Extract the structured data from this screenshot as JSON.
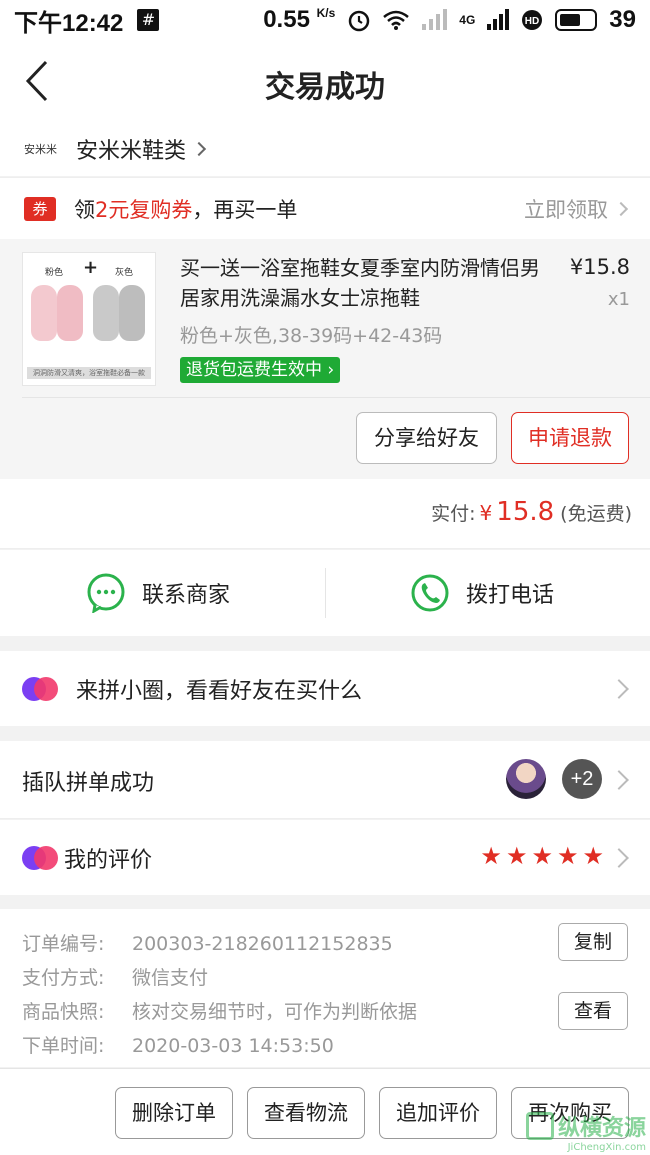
{
  "status_bar": {
    "time": "下午12:42",
    "hash_icon": "#",
    "speed": "0.55",
    "speed_unit": "K/s",
    "network": "4G",
    "battery": "39"
  },
  "header": {
    "title": "交易成功"
  },
  "shop": {
    "logo_text": "安米米",
    "name": "安米米鞋类"
  },
  "coupon": {
    "badge": "券",
    "prefix": "领",
    "highlight": "2元复购券",
    "suffix": "，再买一单",
    "claim": "立即领取"
  },
  "product": {
    "thumb_left_label": "粉色",
    "thumb_right_label": "灰色",
    "thumb_caption": "洞洞防滑又清爽，浴室拖鞋必备一款",
    "title": "买一送一浴室拖鞋女夏季室内防滑情侣男居家用洗澡漏水女士凉拖鞋",
    "price": "¥15.8",
    "qty": "x1",
    "spec": "粉色+灰色,38-39码+42-43码",
    "tag": "退货包运费生效中",
    "share_label": "分享给好友",
    "refund_label": "申请退款"
  },
  "payment": {
    "label": "实付:",
    "currency": "¥",
    "amount": "15.8",
    "shipping": "(免运费)"
  },
  "contact": {
    "merchant_label": "联系商家",
    "phone_label": "拨打电话"
  },
  "circle": {
    "label": "来拼小圈，看看好友在买什么"
  },
  "group": {
    "label": "插队拼单成功",
    "more_count": "+2"
  },
  "review": {
    "label": "我的评价",
    "rating": 5
  },
  "order": {
    "number_key": "订单编号:",
    "number_val": "200303-218260112152835",
    "copy_label": "复制",
    "pay_key": "支付方式:",
    "pay_val": "微信支付",
    "snapshot_key": "商品快照:",
    "snapshot_val": "核对交易细节时，可作为判断依据",
    "view_label": "查看",
    "time_key": "下单时间:",
    "time_val": "2020-03-03 14:53:50"
  },
  "bottom_bar": {
    "delete_label": "删除订单",
    "logistics_label": "查看物流",
    "add_review_label": "追加评价",
    "rebuy_label": "再次购买"
  },
  "watermark": {
    "text": "纵横资源",
    "url": "JiChengXin.com"
  },
  "colors": {
    "brand_red": "#e02e24",
    "green": "#1faa35",
    "wechat_green": "#2bb24c"
  }
}
